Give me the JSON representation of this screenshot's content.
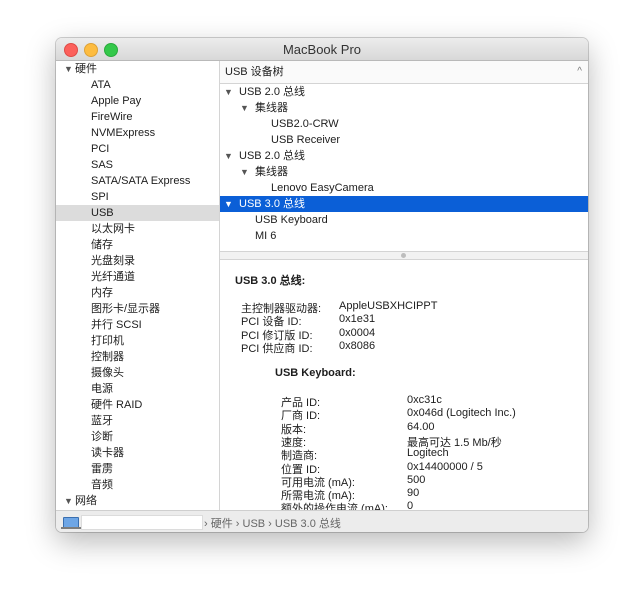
{
  "window": {
    "title": "MacBook Pro"
  },
  "sidebar": {
    "hardware_group": "硬件",
    "items": [
      "ATA",
      "Apple Pay",
      "FireWire",
      "NVMExpress",
      "PCI",
      "SAS",
      "SATA/SATA Express",
      "SPI",
      "USB",
      "以太网卡",
      "储存",
      "光盘刻录",
      "光纤通道",
      "内存",
      "图形卡/显示器",
      "并行 SCSI",
      "打印机",
      "控制器",
      "摄像头",
      "电源",
      "硬件 RAID",
      "蓝牙",
      "诊断",
      "读卡器",
      "雷雳",
      "音频"
    ],
    "selected_item": "USB",
    "network_group": "网络"
  },
  "tree": {
    "header": "USB 设备树",
    "rows": [
      {
        "label": "USB 2.0 总线",
        "level": 0,
        "expanded": true
      },
      {
        "label": "集线器",
        "level": 1,
        "expanded": true
      },
      {
        "label": "USB2.0-CRW",
        "level": 2
      },
      {
        "label": "USB Receiver",
        "level": 2
      },
      {
        "label": "USB 2.0 总线",
        "level": 0,
        "expanded": true
      },
      {
        "label": "集线器",
        "level": 1,
        "expanded": true
      },
      {
        "label": "Lenovo EasyCamera",
        "level": 2
      },
      {
        "label": "USB 3.0 总线",
        "level": 0,
        "expanded": true,
        "selected": true
      },
      {
        "label": "USB Keyboard",
        "level": 1
      },
      {
        "label": "MI 6",
        "level": 1
      }
    ]
  },
  "detail": {
    "title": "USB 3.0 总线:",
    "bus_props": [
      {
        "key": "主控制器驱动器:",
        "value": "AppleUSBXHCIPPT"
      },
      {
        "key": "PCI 设备 ID:",
        "value": "0x1e31"
      },
      {
        "key": "PCI 修订版 ID:",
        "value": "0x0004"
      },
      {
        "key": "PCI 供应商 ID:",
        "value": "0x8086"
      }
    ],
    "device_title": "USB Keyboard:",
    "device_props": [
      {
        "key": "产品 ID:",
        "value": "0xc31c"
      },
      {
        "key": "厂商 ID:",
        "value": "0x046d  (Logitech Inc.)"
      },
      {
        "key": "版本:",
        "value": "64.00"
      },
      {
        "key": "速度:",
        "value": "最高可达 1.5 Mb/秒"
      },
      {
        "key": "制造商:",
        "value": "Logitech"
      },
      {
        "key": "位置 ID:",
        "value": "0x14400000 / 5"
      },
      {
        "key": "可用电流 (mA):",
        "value": "500"
      },
      {
        "key": "所需电流 (mA):",
        "value": "90"
      },
      {
        "key": "额外的操作电流 (mA):",
        "value": "0"
      }
    ]
  },
  "statusbar": {
    "breadcrumb": "›  硬件  ›  USB  ›  USB 3.0 总线"
  },
  "colors": {
    "selection_blue": "#0b5fd7",
    "sidebar_selection": "#dcdcdc",
    "close": "#fc605b",
    "minimize": "#fdbc40",
    "zoom": "#34c84a"
  }
}
